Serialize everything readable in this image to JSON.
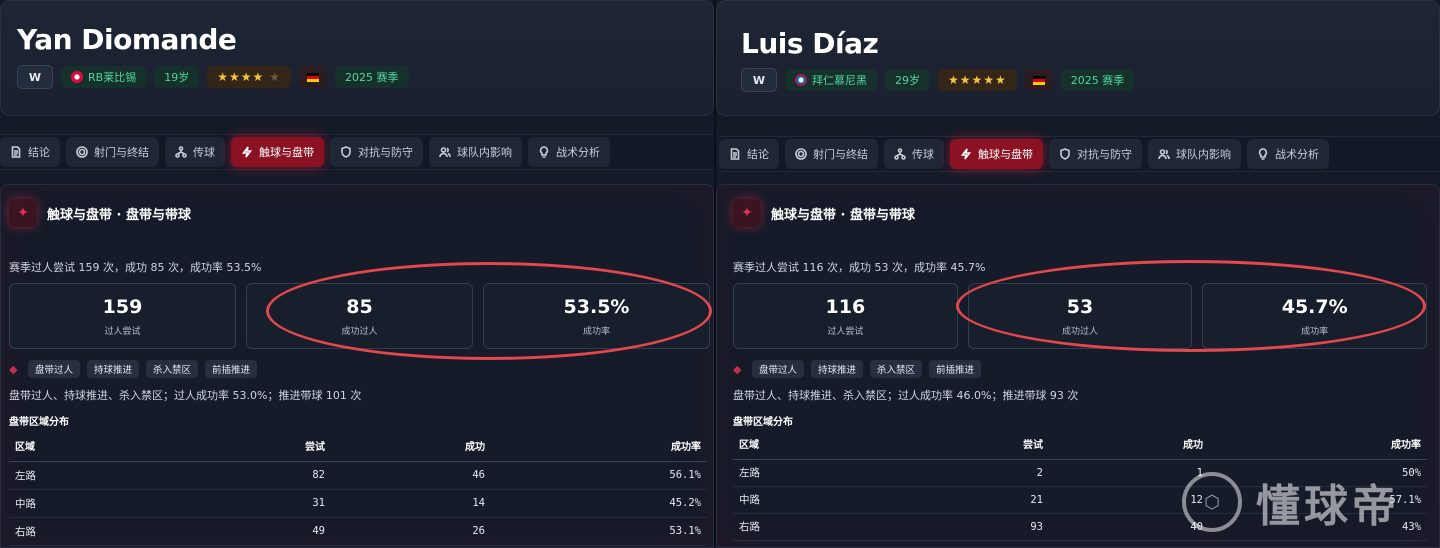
{
  "players": [
    {
      "name": "Yan Diomande",
      "position": "W",
      "club": "RB莱比锡",
      "age": "19岁",
      "rating_stars": 4,
      "rating_max": 5,
      "season": "2025 赛季",
      "tabs": [
        "结论",
        "射门与终结",
        "传球",
        "触球与盘带",
        "对抗与防守",
        "球队内影响",
        "战术分析"
      ],
      "active_tab": "触球与盘带",
      "section_title": "触球与盘带 · 盘带与带球",
      "summary": "赛季过人尝试 159 次，成功 85 次，成功率 53.5%",
      "stats": [
        {
          "value": "159",
          "label": "过人尝试"
        },
        {
          "value": "85",
          "label": "成功过人"
        },
        {
          "value": "53.5%",
          "label": "成功率"
        }
      ],
      "tags": [
        "盘带过人",
        "持球推进",
        "杀入禁区",
        "前插推进"
      ],
      "tag_desc": "盘带过人、持球推进、杀入禁区；过人成功率 53.0%；推进带球 101 次",
      "zone_title": "盘带区域分布",
      "table_headers": [
        "区域",
        "尝试",
        "成功",
        "成功率"
      ],
      "rows": [
        [
          "左路",
          "82",
          "46",
          "56.1%"
        ],
        [
          "中路",
          "31",
          "14",
          "45.2%"
        ],
        [
          "右路",
          "49",
          "26",
          "53.1%"
        ]
      ]
    },
    {
      "name": "Luis Díaz",
      "position": "W",
      "club": "拜仁慕尼黑",
      "age": "29岁",
      "rating_stars": 5,
      "rating_max": 5,
      "season": "2025 赛季",
      "tabs": [
        "结论",
        "射门与终结",
        "传球",
        "触球与盘带",
        "对抗与防守",
        "球队内影响",
        "战术分析"
      ],
      "active_tab": "触球与盘带",
      "section_title": "触球与盘带 · 盘带与带球",
      "summary": "赛季过人尝试 116 次，成功 53 次，成功率 45.7%",
      "stats": [
        {
          "value": "116",
          "label": "过人尝试"
        },
        {
          "value": "53",
          "label": "成功过人"
        },
        {
          "value": "45.7%",
          "label": "成功率"
        }
      ],
      "tags": [
        "盘带过人",
        "持球推进",
        "杀入禁区",
        "前插推进"
      ],
      "tag_desc": "盘带过人、持球推进、杀入禁区；过人成功率 46.0%；推进带球 93 次",
      "zone_title": "盘带区域分布",
      "table_headers": [
        "区域",
        "尝试",
        "成功",
        "成功率"
      ],
      "rows": [
        [
          "左路",
          "2",
          "1",
          "50%"
        ],
        [
          "中路",
          "21",
          "12",
          "57.1%"
        ],
        [
          "右路",
          "93",
          "40",
          "43%"
        ]
      ]
    }
  ],
  "icons": [
    "document-icon",
    "target-icon",
    "network-icon",
    "bolt-icon",
    "shield-icon",
    "users-icon",
    "bulb-icon"
  ],
  "colors": {
    "accent": "#8a1223",
    "highlight_circle": "#e4474c",
    "green_chip": "#4fd6a1",
    "stars": "#f5c542"
  },
  "watermark": "懂球帝"
}
